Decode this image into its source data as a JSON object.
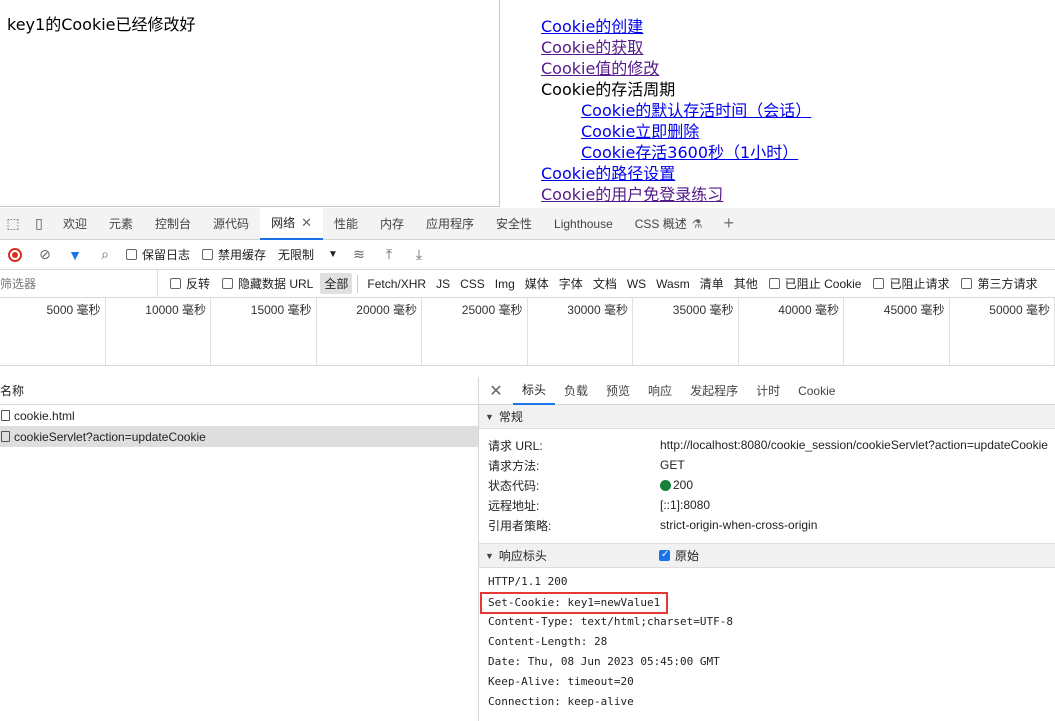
{
  "page": {
    "message": "key1的Cookie已经修改好",
    "links": [
      {
        "label": "Cookie的创建",
        "visited": false,
        "sub": false
      },
      {
        "label": "Cookie的获取",
        "visited": true,
        "sub": false
      },
      {
        "label": "Cookie值的修改",
        "visited": true,
        "sub": false
      },
      {
        "label": "Cookie的存活周期",
        "visited": false,
        "sub": false,
        "plain": true
      },
      {
        "label": "Cookie的默认存活时间（会话）",
        "visited": false,
        "sub": true
      },
      {
        "label": "Cookie立即删除",
        "visited": false,
        "sub": true
      },
      {
        "label": "Cookie存活3600秒（1小时）",
        "visited": false,
        "sub": true
      },
      {
        "label": "Cookie的路径设置",
        "visited": false,
        "sub": false
      },
      {
        "label": "Cookie的用户免登录练习",
        "visited": true,
        "sub": false
      }
    ]
  },
  "devtools": {
    "tabs": [
      "欢迎",
      "元素",
      "控制台",
      "源代码",
      "网络",
      "性能",
      "内存",
      "应用程序",
      "安全性",
      "Lighthouse",
      "CSS 概述"
    ],
    "active_tab": "网络",
    "toolbar": {
      "preserve_log": "保留日志",
      "disable_cache": "禁用缓存",
      "throttle": "无限制"
    },
    "filter": {
      "placeholder": "筛选器",
      "invert": "反转",
      "hide_data_urls": "隐藏数据 URL",
      "types": [
        "全部",
        "Fetch/XHR",
        "JS",
        "CSS",
        "Img",
        "媒体",
        "字体",
        "文档",
        "WS",
        "Wasm",
        "清单",
        "其他"
      ],
      "blocked_cookies": "已阻止 Cookie",
      "blocked_requests": "已阻止请求",
      "third_party": "第三方请求"
    },
    "timeline": [
      "5000 毫秒",
      "10000 毫秒",
      "15000 毫秒",
      "20000 毫秒",
      "25000 毫秒",
      "30000 毫秒",
      "35000 毫秒",
      "40000 毫秒",
      "45000 毫秒",
      "50000 毫秒"
    ],
    "requests": {
      "header": "名称",
      "rows": [
        "cookie.html",
        "cookieServlet?action=updateCookie"
      ]
    },
    "detail": {
      "tabs": [
        "标头",
        "负载",
        "预览",
        "响应",
        "发起程序",
        "计时",
        "Cookie"
      ],
      "general_title": "常规",
      "general": [
        {
          "k": "请求 URL:",
          "v": "http://localhost:8080/cookie_session/cookieServlet?action=updateCookie"
        },
        {
          "k": "请求方法:",
          "v": "GET"
        },
        {
          "k": "状态代码:",
          "v": "200"
        },
        {
          "k": "远程地址:",
          "v": "[::1]:8080"
        },
        {
          "k": "引用者策略:",
          "v": "strict-origin-when-cross-origin"
        }
      ],
      "response_title": "响应标头",
      "raw_label": "原始",
      "raw_lines": [
        "HTTP/1.1 200",
        "Set-Cookie: key1=newValue1",
        "Content-Type: text/html;charset=UTF-8",
        "Content-Length: 28",
        "Date: Thu, 08 Jun 2023 05:45:00 GMT",
        "Keep-Alive: timeout=20",
        "Connection: keep-alive"
      ]
    }
  }
}
